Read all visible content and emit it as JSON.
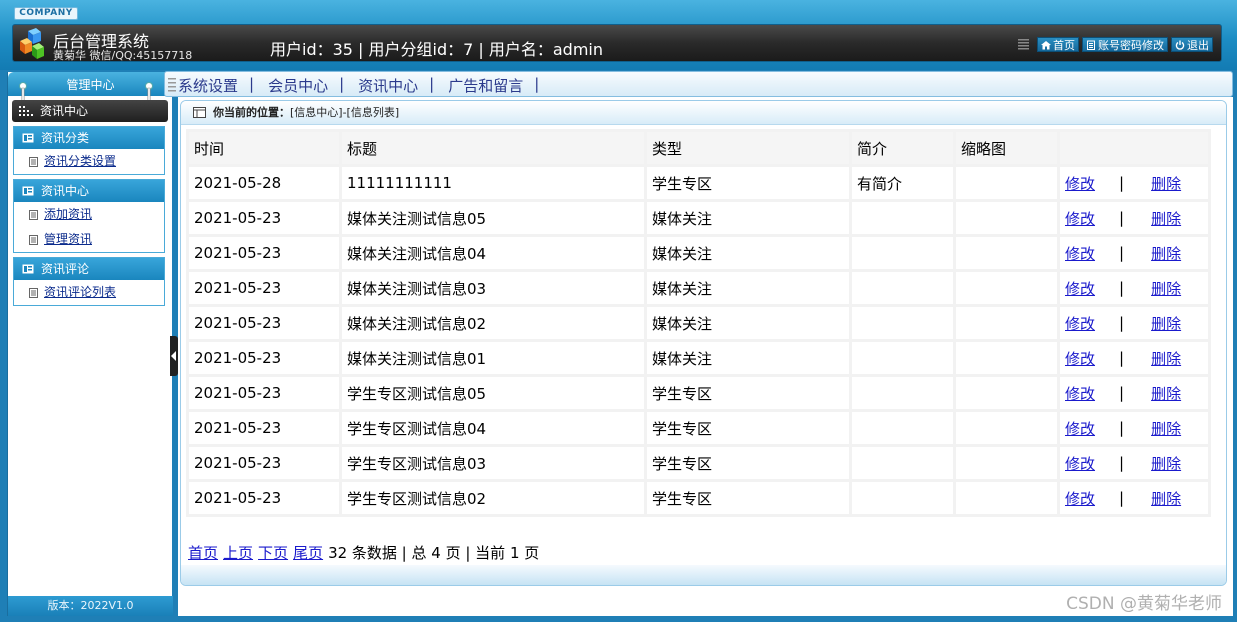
{
  "header": {
    "company_badge": "COMPANY",
    "title": "后台管理系统",
    "author": "黄菊华 微信/QQ:45157718",
    "user_info": "用户id：35 | 用户分组id：7 | 用户名：admin",
    "links": [
      {
        "label": "首页",
        "icon": "home-icon"
      },
      {
        "label": "账号密码修改",
        "icon": "document-icon"
      },
      {
        "label": "退出",
        "icon": "power-icon"
      }
    ]
  },
  "sidebar": {
    "title": "管理中心",
    "current": "资讯中心",
    "groups": [
      {
        "title": "资讯分类",
        "items": [
          "资讯分类设置"
        ]
      },
      {
        "title": "资讯中心",
        "items": [
          "添加资讯",
          "管理资讯"
        ]
      },
      {
        "title": "资讯评论",
        "items": [
          "资讯评论列表"
        ]
      }
    ],
    "version": "版本：2022V1.0"
  },
  "menu": {
    "items": [
      "系统设置",
      "会员中心",
      "资讯中心",
      "广告和留言"
    ],
    "separator": "|"
  },
  "breadcrumb": {
    "label": "你当前的位置：",
    "path": "[信息中心]-[信息列表]"
  },
  "table": {
    "headers": [
      "时间",
      "标题",
      "类型",
      "简介",
      "缩略图",
      ""
    ],
    "edit_label": "修改",
    "delete_label": "删除",
    "op_separator": "|",
    "rows": [
      {
        "time": "2021-05-28",
        "title": "11111111111",
        "type": "学生专区",
        "brief": "有简介",
        "thumb": ""
      },
      {
        "time": "2021-05-23",
        "title": "媒体关注测试信息05",
        "type": "媒体关注",
        "brief": "",
        "thumb": ""
      },
      {
        "time": "2021-05-23",
        "title": "媒体关注测试信息04",
        "type": "媒体关注",
        "brief": "",
        "thumb": ""
      },
      {
        "time": "2021-05-23",
        "title": "媒体关注测试信息03",
        "type": "媒体关注",
        "brief": "",
        "thumb": ""
      },
      {
        "time": "2021-05-23",
        "title": "媒体关注测试信息02",
        "type": "媒体关注",
        "brief": "",
        "thumb": ""
      },
      {
        "time": "2021-05-23",
        "title": "媒体关注测试信息01",
        "type": "媒体关注",
        "brief": "",
        "thumb": ""
      },
      {
        "time": "2021-05-23",
        "title": "学生专区测试信息05",
        "type": "学生专区",
        "brief": "",
        "thumb": ""
      },
      {
        "time": "2021-05-23",
        "title": "学生专区测试信息04",
        "type": "学生专区",
        "brief": "",
        "thumb": ""
      },
      {
        "time": "2021-05-23",
        "title": "学生专区测试信息03",
        "type": "学生专区",
        "brief": "",
        "thumb": ""
      },
      {
        "time": "2021-05-23",
        "title": "学生专区测试信息02",
        "type": "学生专区",
        "brief": "",
        "thumb": ""
      }
    ]
  },
  "pager": {
    "first": "首页",
    "prev": "上页",
    "next": "下页",
    "last": "尾页",
    "summary": "32 条数据 | 总 4 页 | 当前 1 页"
  },
  "watermark": "CSDN @黄菊华老师"
}
